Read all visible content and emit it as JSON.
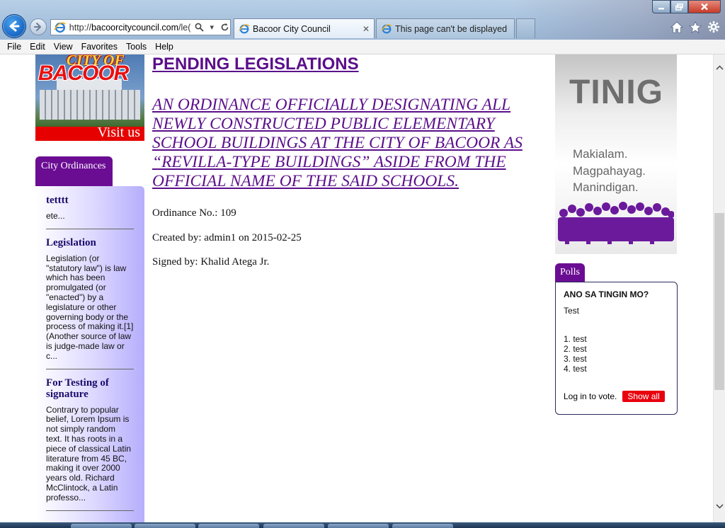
{
  "browser": {
    "url_prefix": "http://",
    "url_domain": "bacoorcitycouncil.com",
    "url_rest": "/le(",
    "tabs": [
      {
        "label": "Bacoor City Council",
        "active": true
      },
      {
        "label": "This page can't be displayed",
        "active": false
      }
    ]
  },
  "menu": [
    "File",
    "Edit",
    "View",
    "Favorites",
    "Tools",
    "Help"
  ],
  "logo": {
    "line1": "CITY OF",
    "line2": "BACOOR",
    "visit": "Visit us"
  },
  "sidebar": {
    "tab_label": "City Ordinances",
    "items": [
      {
        "title": "tetttt",
        "text": "ete..."
      },
      {
        "title": "Legislation",
        "text": "Legislation (or \"statutory law\") is law which has been promulgated (or \"enacted\") by a legislature or other governing body or the process of making it.[1] (Another source of law is judge-made law or c..."
      },
      {
        "title": "For Testing of signature",
        "text": "Contrary to popular belief, Lorem Ipsum is not simply random text. It has roots in a piece of classical Latin literature from 45 BC, making it over 2000 years old. Richard McClintock, a Latin professo..."
      }
    ]
  },
  "main": {
    "heading": "PENDING LEGISLATIONS",
    "ordinance_title": "AN ORDINANCE OFFICIALLY DESIGNATING ALL NEWLY CONSTRUCTED PUBLIC ELEMENTARY SCHOOL BUILDINGS AT THE CITY OF BACOOR AS “REVILLA-TYPE BUILDINGS” ASIDE FROM THE OFFICIAL NAME OF THE SAID SCHOOLS.",
    "ordinance_no": "Ordinance No.: 109",
    "created_by": "Created by: admin1 on 2015-02-25",
    "signed_by": "Signed by: Khalid Atega Jr."
  },
  "banner": {
    "brand": "TINIG",
    "slogan": [
      "Makialam.",
      "Magpahayag.",
      "Manindigan."
    ]
  },
  "polls": {
    "tab_label": "Polls",
    "question": "ANO SA TINGIN MO?",
    "description": "Test",
    "options": [
      "1. test",
      "2. test",
      "3. test",
      "4. test"
    ],
    "login_text": "Log in to vote.",
    "show_all_label": "Show all"
  },
  "colors": {
    "accent_purple": "#6a0d93",
    "link_purple": "#5b0f8b",
    "show_all_red": "#e8000d"
  }
}
